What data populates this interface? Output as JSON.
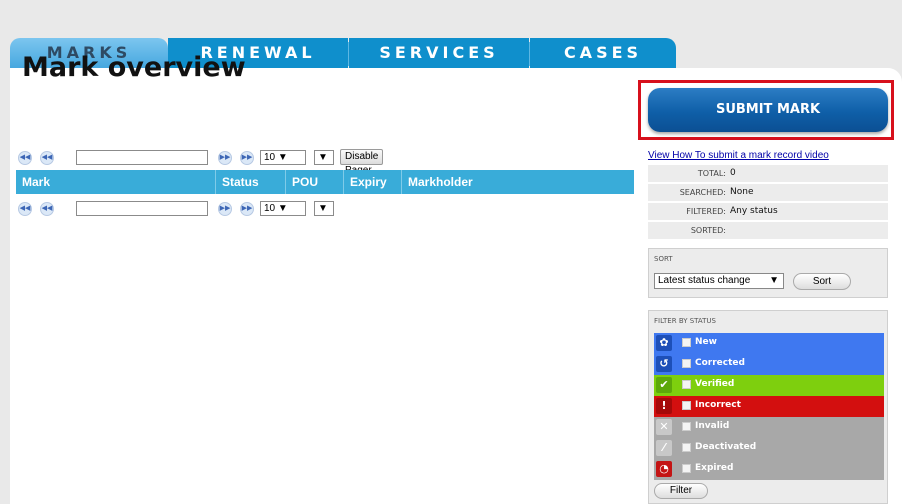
{
  "tabs": [
    {
      "label": "MARKS",
      "active": true
    },
    {
      "label": "RENEWAL",
      "active": false
    },
    {
      "label": "SERVICES",
      "active": false
    },
    {
      "label": "CASES",
      "active": false
    }
  ],
  "page_title": "Mark overview",
  "pager": {
    "first_icon": "first-page-icon",
    "prev_icon": "previous-page-icon",
    "next_icon": "next-page-icon",
    "last_icon": "last-page-icon",
    "page_value": "",
    "page_size": "10 ▼",
    "extra_select": "▼",
    "disable_label": "Disable Pager"
  },
  "table": {
    "columns": [
      "Mark",
      "Status",
      "POU",
      "Expiry",
      "Markholder"
    ]
  },
  "sidebar": {
    "submit_label": "SUBMIT MARK",
    "video_link": "View How To submit a mark record video",
    "stats": [
      {
        "label": "TOTAL:",
        "value": "0"
      },
      {
        "label": "SEARCHED:",
        "value": "None"
      },
      {
        "label": "FILTERED:",
        "value": "Any status"
      },
      {
        "label": "SORTED:",
        "value": ""
      }
    ],
    "sort": {
      "title": "SORT",
      "selected": "Latest status change",
      "arrow": "▼",
      "button": "Sort"
    },
    "filter": {
      "title": "FILTER BY STATUS",
      "items": [
        {
          "label": "New",
          "color": "#3f78f0",
          "icon": "gear-icon",
          "glyph": "✿",
          "icon_bg": "#1d4fb8"
        },
        {
          "label": "Corrected",
          "color": "#3f78f0",
          "icon": "refresh-icon",
          "glyph": "↺",
          "icon_bg": "#1d4fb8"
        },
        {
          "label": "Verified",
          "color": "#7ecf0e",
          "icon": "checkmark-icon",
          "glyph": "✔",
          "icon_bg": "#5da80a"
        },
        {
          "label": "Incorrect",
          "color": "#d30f0f",
          "icon": "warning-icon",
          "glyph": "!",
          "icon_bg": "#a50909"
        },
        {
          "label": "Invalid",
          "color": "#a8a8a8",
          "icon": "cross-icon",
          "glyph": "✕",
          "icon_bg": "#c8c8c8"
        },
        {
          "label": "Deactivated",
          "color": "#a8a8a8",
          "icon": "slash-icon",
          "glyph": "⁄",
          "icon_bg": "#c8c8c8"
        },
        {
          "label": "Expired",
          "color": "#a8a8a8",
          "icon": "clock-icon",
          "glyph": "◔",
          "icon_bg": "#c41414"
        }
      ],
      "button": "Filter"
    }
  }
}
